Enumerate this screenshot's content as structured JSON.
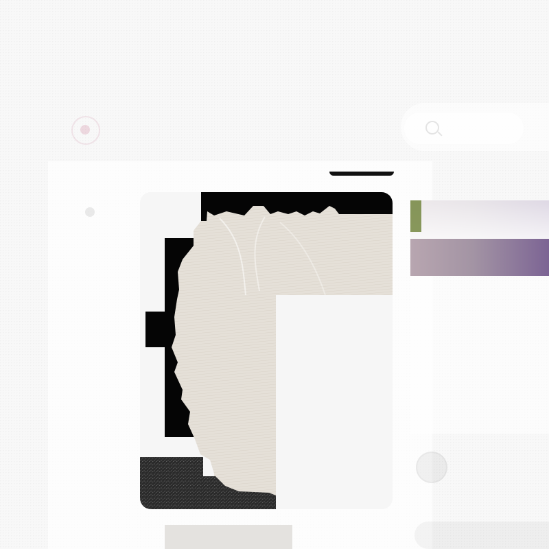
{
  "header": {
    "title": "",
    "subtitle": "",
    "meta": ""
  },
  "nav": {
    "items": [
      {
        "label": ""
      },
      {
        "label": ""
      },
      {
        "label": ""
      },
      {
        "label": ""
      }
    ]
  },
  "search": {
    "label": ""
  },
  "card": {
    "label": ""
  },
  "author": {
    "name": "",
    "subtitle": ""
  },
  "colors": {
    "brand": "#b5345e",
    "photo_dark": "#050505",
    "photo_light": "#e5e0d8",
    "side_purple": "#7c6494"
  }
}
